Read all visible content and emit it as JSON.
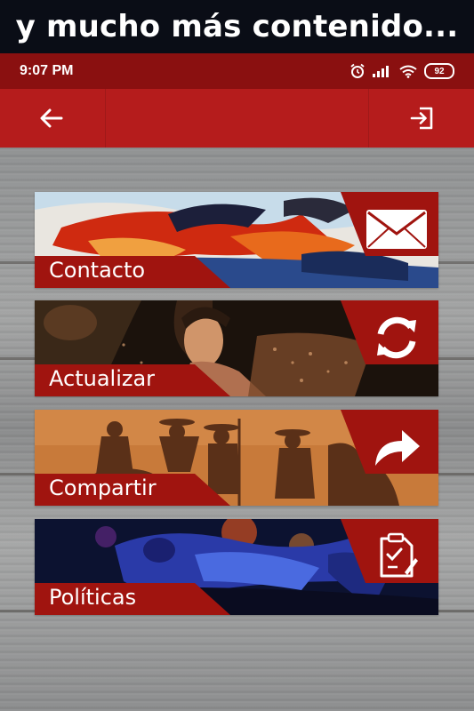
{
  "promo": {
    "text": "y mucho más contenido..."
  },
  "status_bar": {
    "time": "9:07 PM",
    "battery": "92"
  },
  "toolbar": {
    "back_icon": "arrow-left-icon",
    "exit_icon": "exit-icon"
  },
  "menu": {
    "items": [
      {
        "label": "Contacto",
        "icon": "envelope-icon"
      },
      {
        "label": "Actualizar",
        "icon": "refresh-icon"
      },
      {
        "label": "Compartir",
        "icon": "share-arrow-icon"
      },
      {
        "label": "Políticas",
        "icon": "policy-document-icon"
      }
    ]
  },
  "colors": {
    "primary_red": "#b51c1c",
    "dark_red": "#8a1010",
    "card_red": "#9e1212"
  }
}
